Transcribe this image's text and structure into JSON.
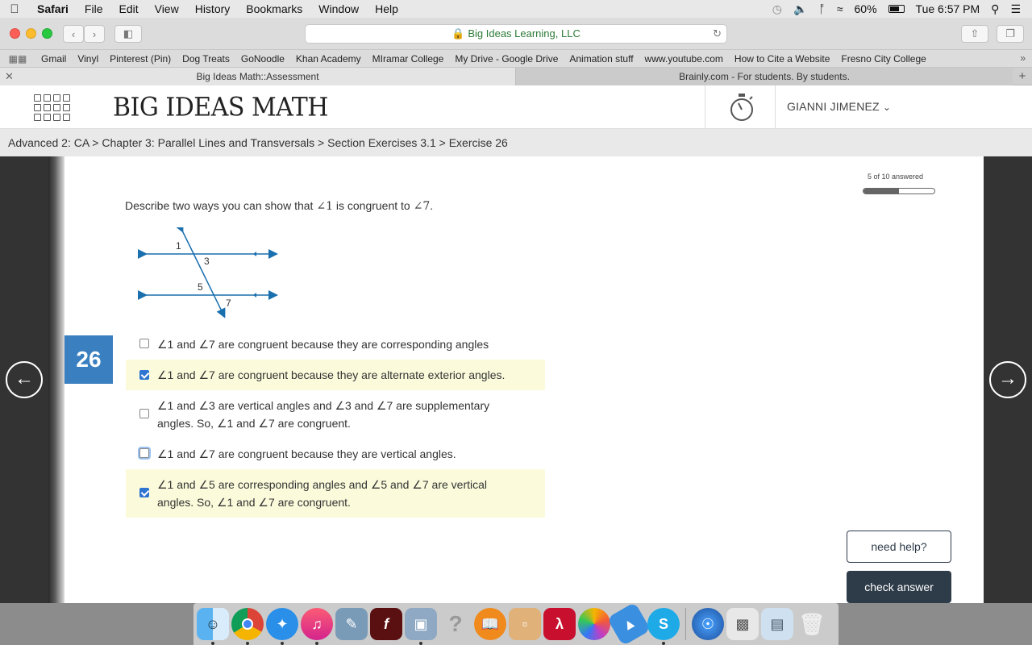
{
  "menubar": {
    "app": "Safari",
    "items": [
      "File",
      "Edit",
      "View",
      "History",
      "Bookmarks",
      "Window",
      "Help"
    ],
    "battery": "60%",
    "clock": "Tue 6:57 PM"
  },
  "browser": {
    "url": "Big Ideas Learning, LLC",
    "bookmarks": [
      "Gmail",
      "Vinyl",
      "Pinterest (Pin)",
      "Dog Treats",
      "GoNoodle",
      "Khan Academy",
      "MIramar College",
      "My Drive - Google Drive",
      "Animation stuff",
      "www.youtube.com",
      "How to Cite a Website",
      "Fresno City College"
    ],
    "tabs": [
      {
        "label": "Big Ideas Math::Assessment"
      },
      {
        "label": "Brainly.com - For students. By students."
      }
    ]
  },
  "site": {
    "logo": "BIG IDEAS MATH",
    "user": "GIANNI JIMENEZ",
    "breadcrumb": "Advanced 2: CA > Chapter 3: Parallel Lines and Transversals > Section Exercises 3.1 > Exercise 26"
  },
  "progress": {
    "label": "5 of 10 answered",
    "fraction": 0.5
  },
  "question": {
    "number": "26",
    "prompt_start": "Describe two ways you can show that ",
    "a1": "∠1",
    "prompt_mid": " is congruent to ",
    "a7": "∠7",
    "prompt_end": ".",
    "figure_labels": [
      "1",
      "3",
      "5",
      "7"
    ]
  },
  "options": [
    {
      "line1": "∠1 and ∠7 are congruent because they are corresponding angles",
      "line2": "",
      "checked": false
    },
    {
      "line1": "∠1 and ∠7 are congruent because they are alternate exterior angles.",
      "line2": "",
      "checked": true
    },
    {
      "line1": "∠1 and ∠3 are vertical angles and ∠3 and ∠7 are supplementary",
      "line2": "angles. So, ∠1 and ∠7 are congruent.",
      "checked": false
    },
    {
      "line1": "∠1 and ∠7 are congruent because they are vertical angles.",
      "line2": "",
      "checked": false
    },
    {
      "line1": "∠1 and ∠5 are corresponding angles and ∠5 and ∠7 are vertical",
      "line2": "angles. So, ∠1 and ∠7 are congruent.",
      "checked": true
    }
  ],
  "buttons": {
    "help": "need help?",
    "check": "check answer"
  },
  "nav": {
    "prev": "←",
    "next": "→"
  },
  "colors": {
    "accent": "#3a7fbf",
    "selected_bg": "#fbfbdc",
    "dark_button": "#2e3b49",
    "figure_line": "#1a6fae"
  }
}
